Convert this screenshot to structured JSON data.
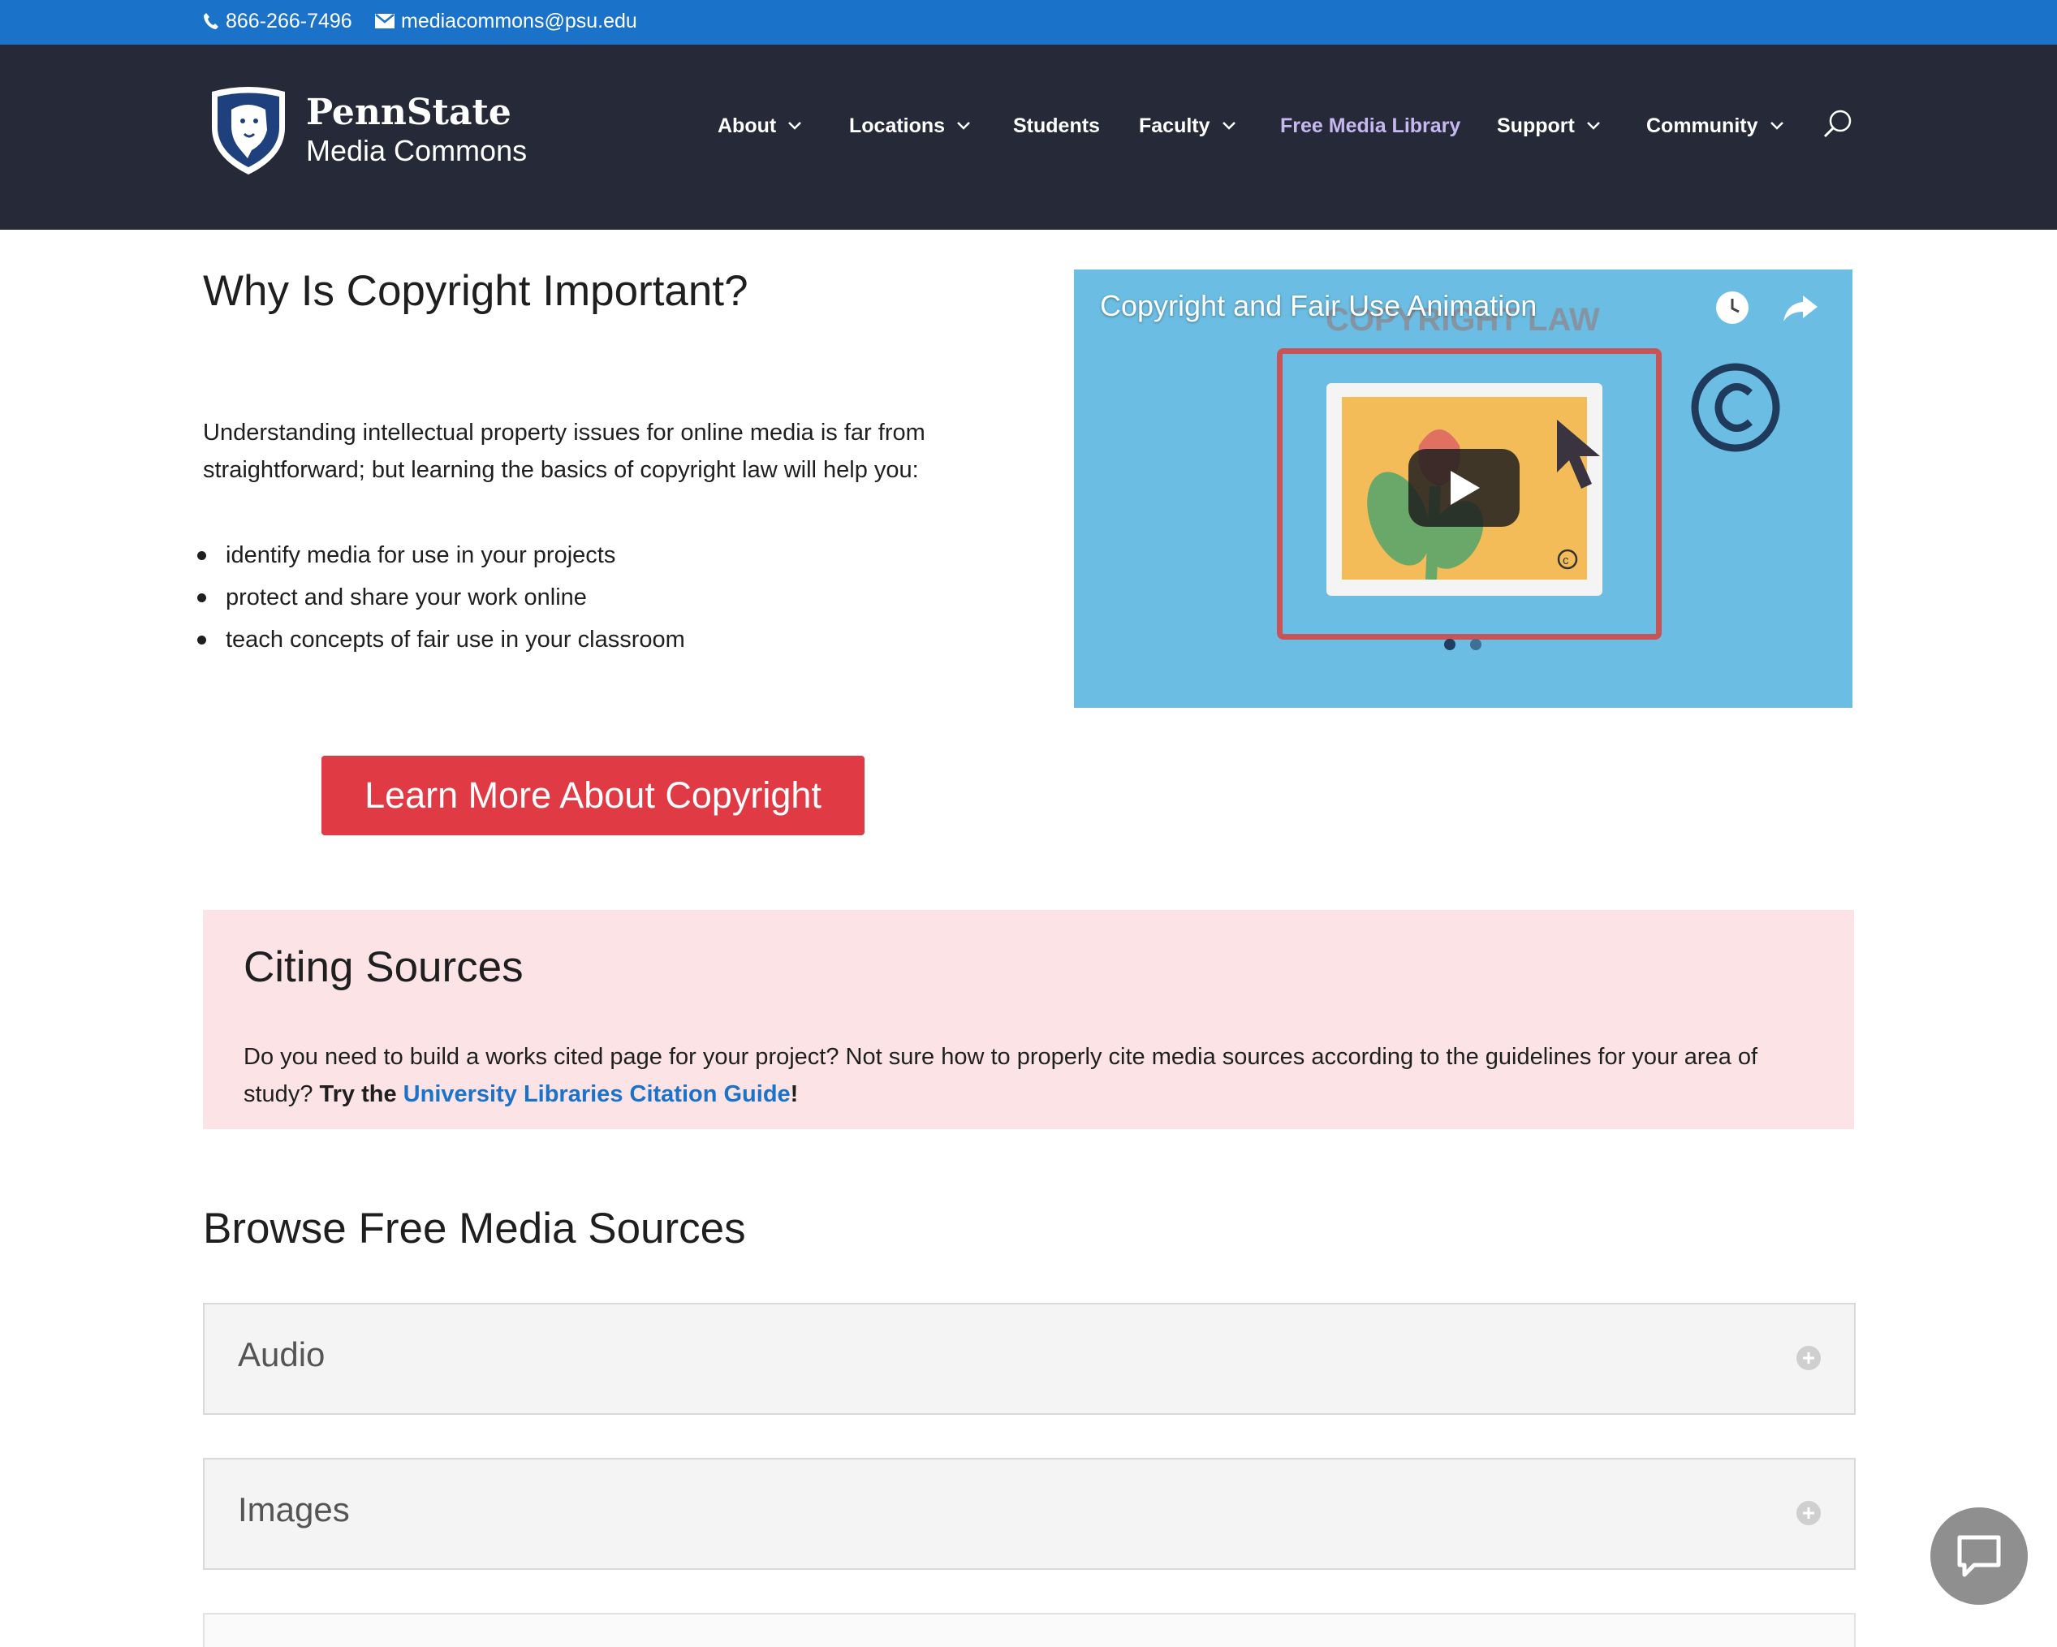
{
  "topbar": {
    "phone": "866-266-7496",
    "email": "mediacommons@psu.edu"
  },
  "logo": {
    "line1": "PennState",
    "line2": "Media Commons"
  },
  "nav": {
    "about": "About",
    "locations": "Locations",
    "students": "Students",
    "faculty": "Faculty",
    "free_media_library": "Free Media Library",
    "support": "Support",
    "community": "Community"
  },
  "intro": {
    "title": "Why Is Copyright Important?",
    "paragraph": "Understanding intellectual property issues for online media is far from straightforward; but learning the basics of copyright law will help you:",
    "bullets": [
      "identify media for use in your projects",
      "protect and share your work online",
      "teach concepts of fair use in your classroom"
    ],
    "button": "Learn More About Copyright"
  },
  "video": {
    "title": "Copyright and Fair Use Animation",
    "background_text": "COPYRIGHT LAW"
  },
  "citing": {
    "title": "Citing Sources",
    "text_1": "Do you need to build a works cited page for your project? Not sure how to properly cite media sources according to the guidelines for your area of study? ",
    "bold_prefix": "Try the ",
    "link": "University Libraries Citation Guide",
    "bold_suffix": "!"
  },
  "browse": {
    "title": "Browse Free Media Sources",
    "sections": [
      "Audio",
      "Images"
    ]
  },
  "colors": {
    "topbar": "#1a73c9",
    "header": "#262a38",
    "accent_red": "#e03a45",
    "cite_bg": "#fbe3e6",
    "nav_active": "#c7b8f0"
  }
}
